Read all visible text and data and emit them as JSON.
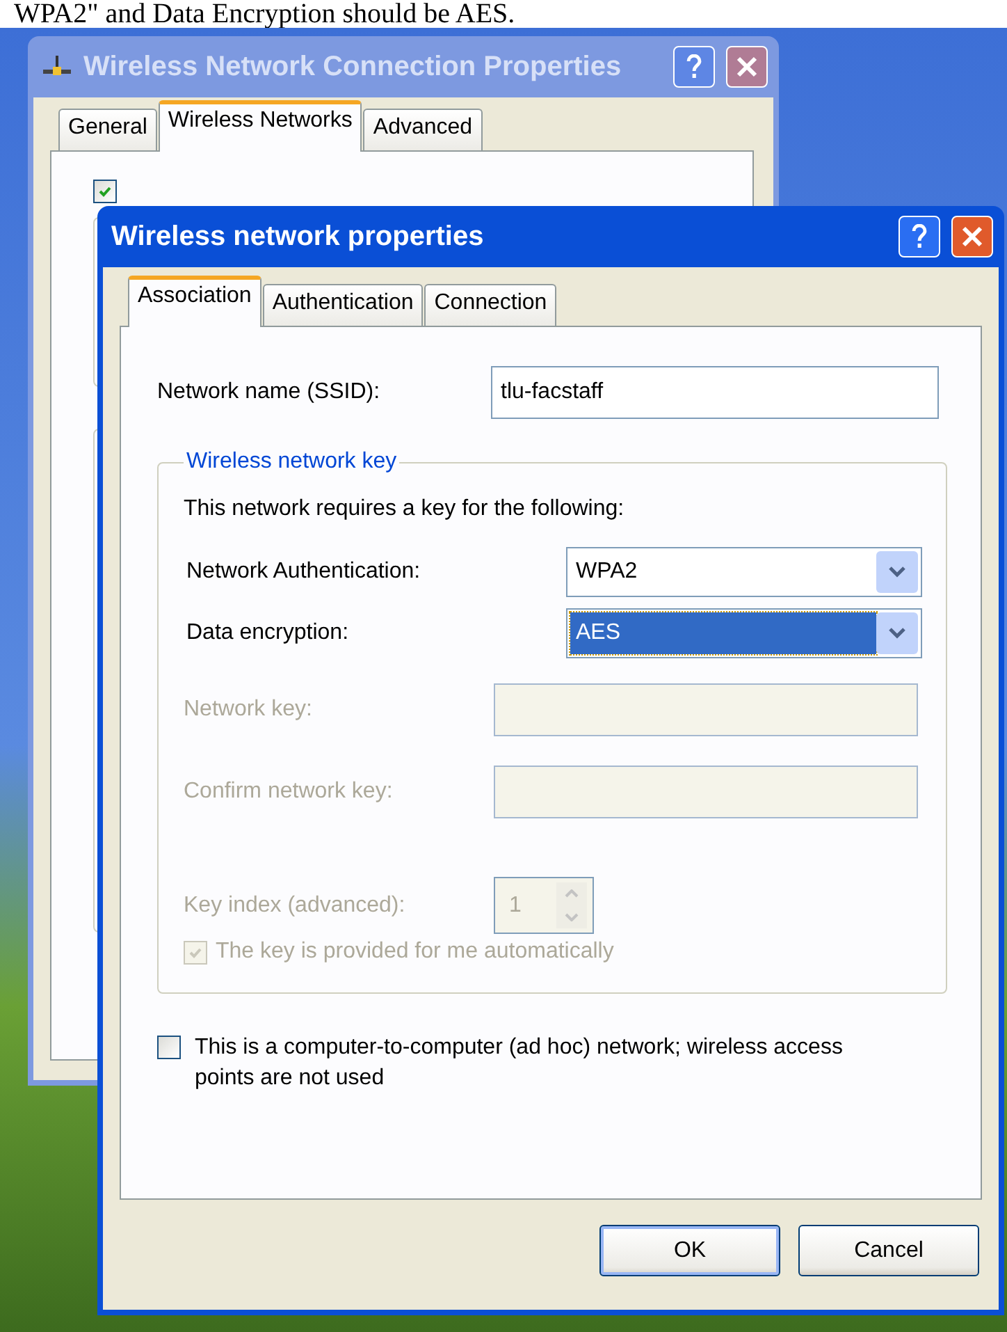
{
  "caption": {
    "text": "WPA2\" and Data Encryption should be AES."
  },
  "back_window": {
    "title": "Wireless Network Connection Properties",
    "active": false,
    "tabs": [
      {
        "label": "General",
        "selected": false
      },
      {
        "label": "Wireless Networks",
        "selected": true
      },
      {
        "label": "Advanced",
        "selected": false
      }
    ],
    "use_windows_checkbox": {
      "checked": true
    }
  },
  "front_window": {
    "title": "Wireless network properties",
    "active": true,
    "tabs": [
      {
        "label": "Association",
        "selected": true
      },
      {
        "label": "Authentication",
        "selected": false
      },
      {
        "label": "Connection",
        "selected": false
      }
    ],
    "ssid": {
      "label": "Network name (SSID):",
      "value": "tlu-facstaff"
    },
    "key_group": {
      "title": "Wireless network key",
      "intro": "This network requires a key for the following:",
      "network_authentication": {
        "label": "Network Authentication:",
        "value": "WPA2",
        "focused": false
      },
      "data_encryption": {
        "label": "Data encryption:",
        "value": "AES",
        "focused": true
      },
      "network_key": {
        "label": "Network key:",
        "disabled": true
      },
      "confirm_key": {
        "label": "Confirm network key:",
        "disabled": true
      },
      "key_index": {
        "label": "Key index (advanced):",
        "value": "1",
        "disabled": true
      },
      "auto_key": {
        "label": "The key is provided for me automatically",
        "checked": true,
        "disabled": true
      }
    },
    "adhoc": {
      "label": "This is a computer-to-computer (ad hoc) network; wireless access points are not used",
      "checked": false
    },
    "buttons": [
      {
        "label": "OK",
        "default": true
      },
      {
        "label": "Cancel",
        "default": false
      }
    ]
  }
}
